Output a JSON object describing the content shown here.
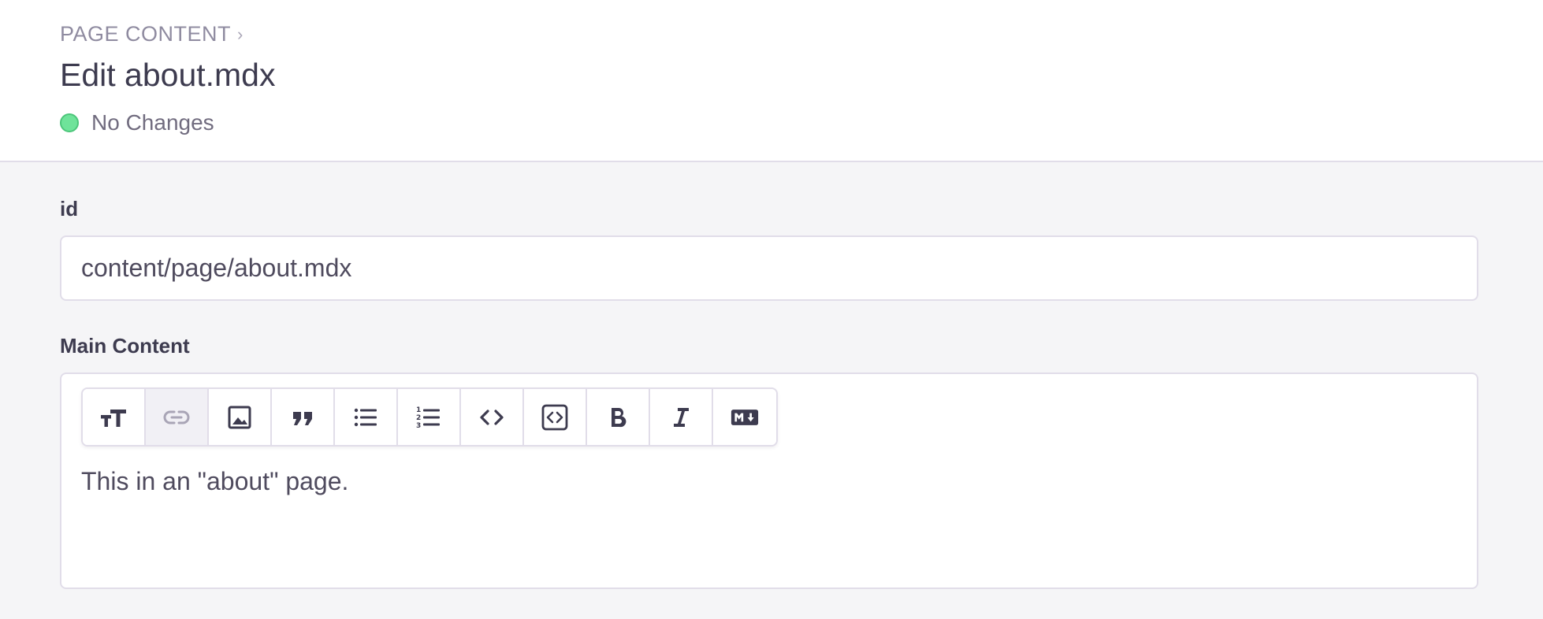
{
  "header": {
    "breadcrumb": "PAGE CONTENT",
    "breadcrumb_separator": "›",
    "title": "Edit about.mdx",
    "status": "No Changes",
    "status_color": "#6fe39a"
  },
  "fields": {
    "id": {
      "label": "id",
      "value": "content/page/about.mdx"
    },
    "main_content": {
      "label": "Main Content",
      "text": "This in an \"about\" page."
    }
  },
  "toolbar": {
    "buttons": [
      {
        "icon": "text-size-icon",
        "active": false
      },
      {
        "icon": "link-icon",
        "active": true
      },
      {
        "icon": "image-icon",
        "active": false
      },
      {
        "icon": "quote-icon",
        "active": false
      },
      {
        "icon": "bullet-list-icon",
        "active": false
      },
      {
        "icon": "numbered-list-icon",
        "active": false
      },
      {
        "icon": "code-icon",
        "active": false
      },
      {
        "icon": "code-block-icon",
        "active": false
      },
      {
        "icon": "bold-icon",
        "active": false
      },
      {
        "icon": "italic-icon",
        "active": false
      },
      {
        "icon": "markdown-icon",
        "active": false
      }
    ]
  },
  "colors": {
    "accent_text": "#3d3b4f",
    "border": "#e1dde9",
    "background": "#f5f5f7"
  }
}
